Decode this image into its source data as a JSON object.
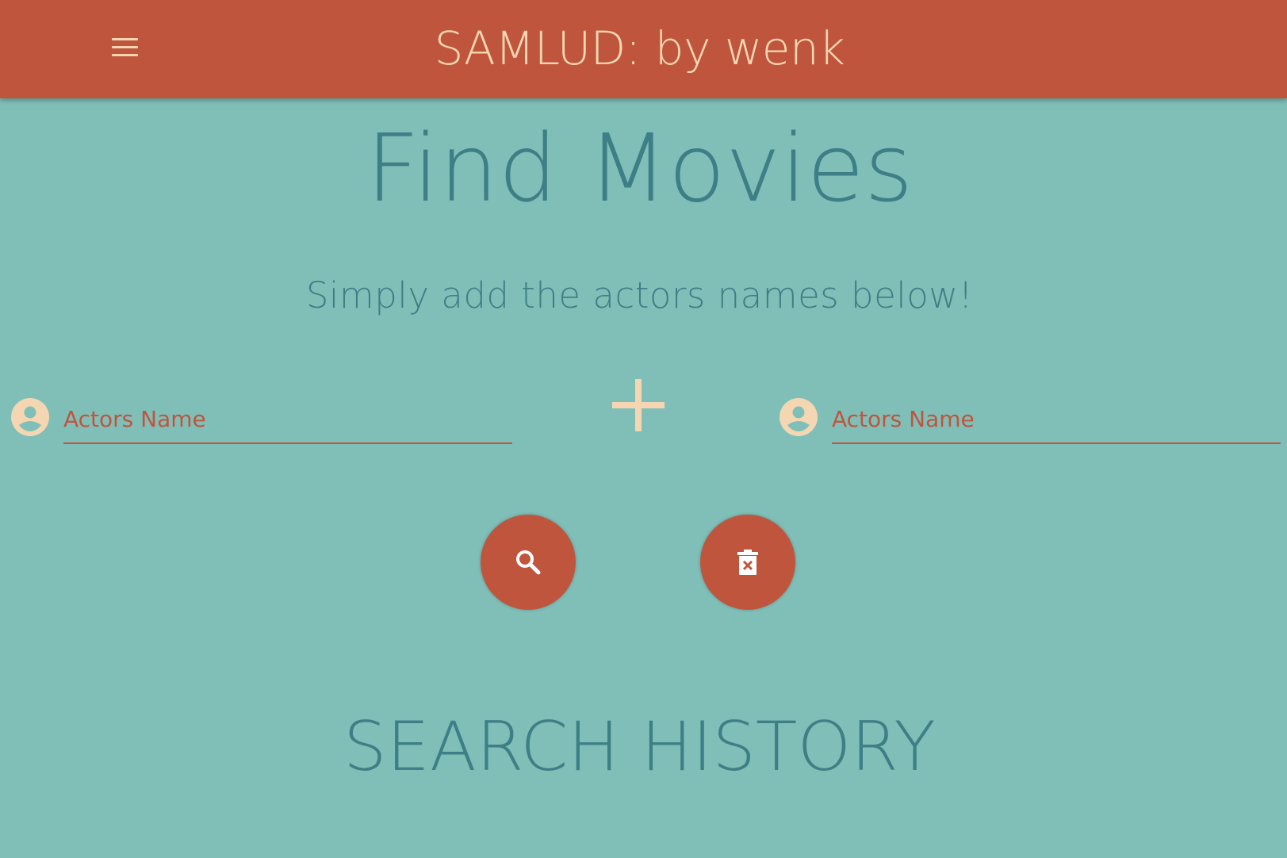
{
  "header": {
    "title": "SAMLUD: by wenk",
    "menu_icon": "hamburger-menu-icon"
  },
  "main": {
    "title": "Find Movies",
    "subtitle": "Simply add the actors names below!",
    "actor_inputs": [
      {
        "placeholder": "Actors Name",
        "value": "",
        "icon": "person-icon"
      },
      {
        "placeholder": "Actors Name",
        "value": "",
        "icon": "person-icon"
      }
    ],
    "separator_icon": "plus-icon",
    "actions": [
      {
        "name": "search",
        "icon": "search-icon"
      },
      {
        "name": "clear",
        "icon": "trash-x-icon"
      }
    ]
  },
  "history": {
    "title": "SEARCH HISTORY"
  },
  "colors": {
    "background": "#80bfb8",
    "header": "#c0553d",
    "accent_text": "#f4d7b2",
    "primary_text": "#3e7f87",
    "input_text": "#c0553d"
  }
}
